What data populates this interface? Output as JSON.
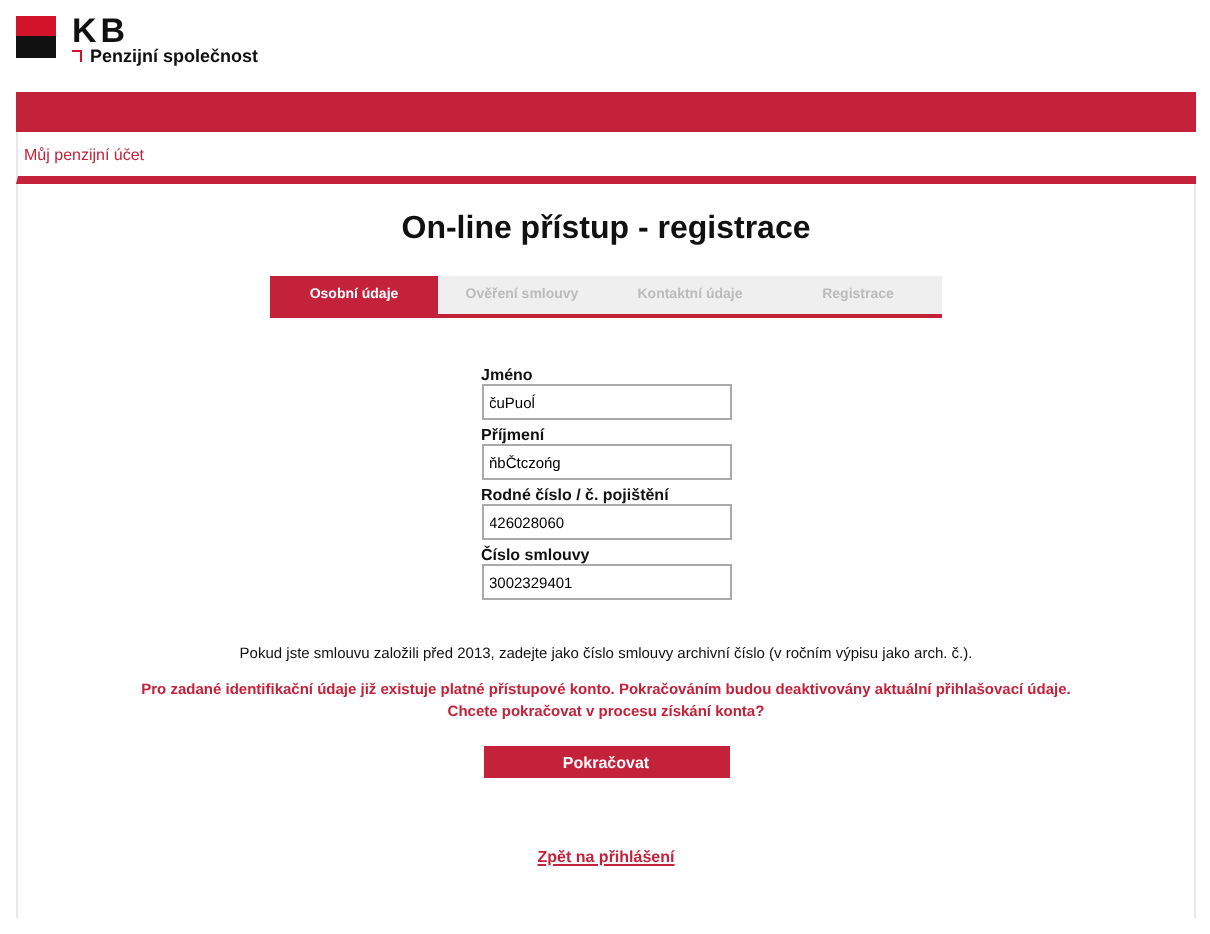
{
  "logo": {
    "brand": "KB",
    "subtitle": "Penzijní společnost"
  },
  "nav": {
    "link": "Můj penzijní účet"
  },
  "title": "On-line přístup - registrace",
  "steps": [
    {
      "label": "Osobní údaje",
      "selected": true
    },
    {
      "label": "Ověření smlouvy",
      "selected": false
    },
    {
      "label": "Kontaktní údaje",
      "selected": false
    },
    {
      "label": "Registrace",
      "selected": false
    }
  ],
  "fields": [
    {
      "label": "Jméno",
      "value": "čuPuoĺ"
    },
    {
      "label": "Příjmení",
      "value": "ňbČtczońg"
    },
    {
      "label": "Rodné číslo / č. pojištění",
      "value": "426028060"
    },
    {
      "label": "Číslo smlouvy",
      "value": "3002329401"
    }
  ],
  "note": "Pokud jste smlouvu založili před 2013, zadejte jako číslo smlouvy archivní číslo (v ročním výpisu jako arch. č.).",
  "warning": [
    "Pro zadané identifikační údaje již existuje platné přístupové konto. Pokračováním budou deaktivovány aktuální přihlašovací údaje.",
    "Chcete pokračovat v procesu získání konta?"
  ],
  "button": "Pokračovat",
  "back_link": "Zpět na přihlášení"
}
